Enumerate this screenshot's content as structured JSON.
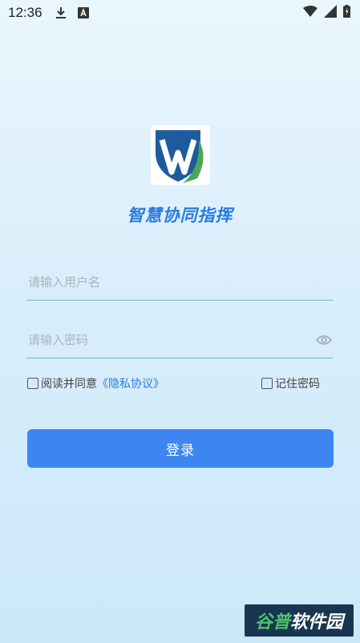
{
  "status_bar": {
    "time": "12:36",
    "icons": [
      "download-icon",
      "a-box-icon",
      "wifi-icon",
      "signal-icon",
      "battery-icon"
    ]
  },
  "app": {
    "title": "智慧协同指挥",
    "logo": "shield-w-logo"
  },
  "form": {
    "username_placeholder": "请输入用户名",
    "password_placeholder": "请输入密码",
    "agree_text": "阅读并同意",
    "privacy_link": "《隐私协议》",
    "remember_label": "记住密码",
    "login_label": "登录"
  },
  "watermark": {
    "part1": "谷普",
    "part2": "软件园"
  },
  "colors": {
    "accent": "#3d86f2",
    "title": "#2a7be0",
    "underline": "#6cbac8"
  }
}
